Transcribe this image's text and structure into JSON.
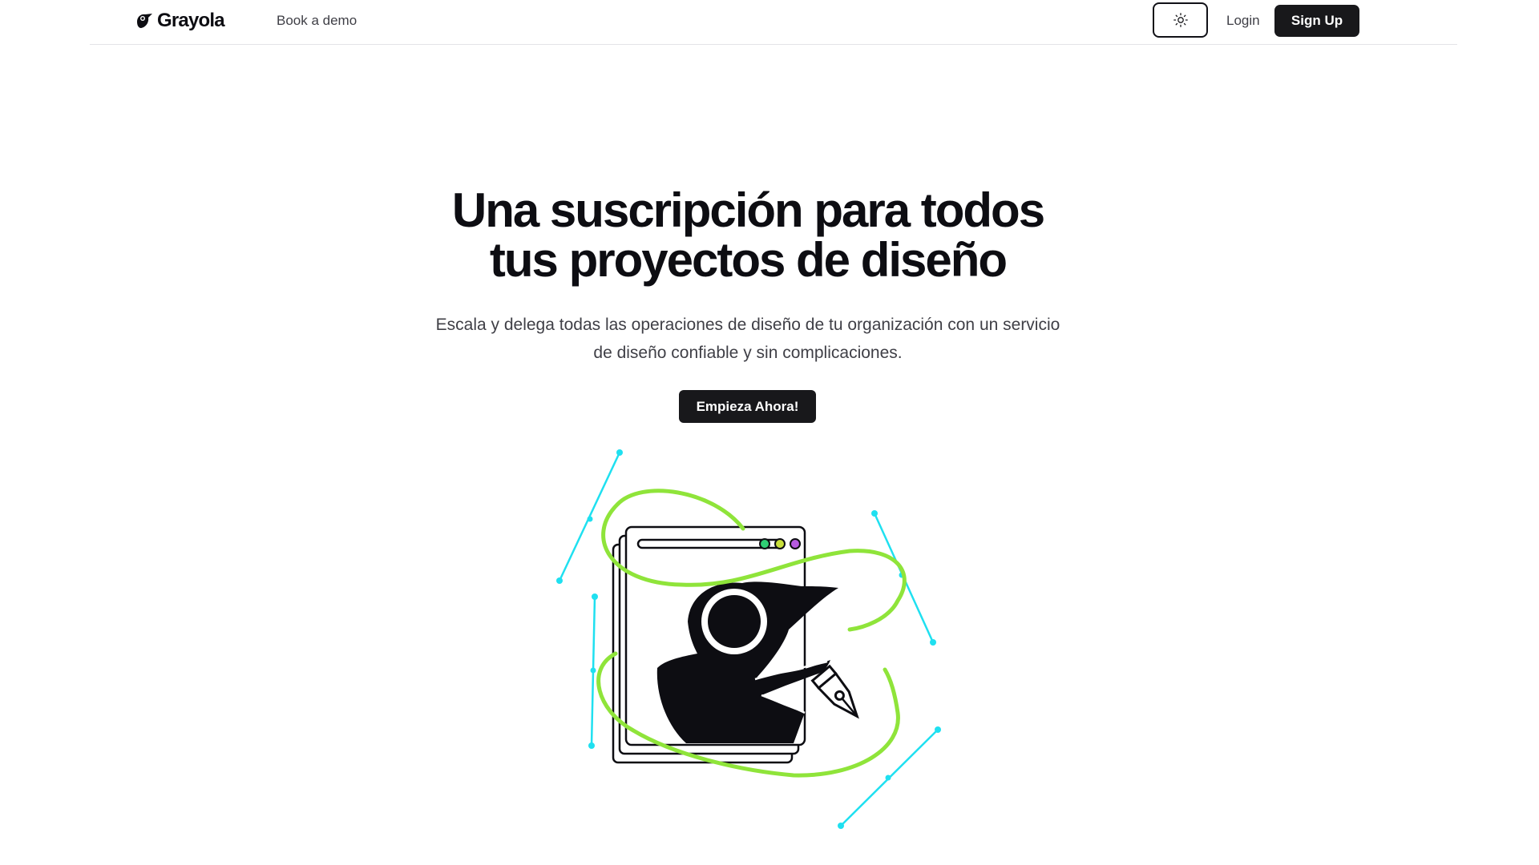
{
  "header": {
    "brand": "Grayola",
    "nav": {
      "book_demo": "Book a demo"
    },
    "theme_toggle_icon": "sun-icon",
    "login": "Login",
    "signup": "Sign Up"
  },
  "hero": {
    "title_lines": [
      "Una suscripción para todos",
      "tus proyectos de diseño"
    ],
    "subtitle_lines": [
      "Escala y delega todas las operaciones de diseño de tu organización con un servicio",
      "de diseño confiable y sin complicaciones."
    ],
    "cta": "Empieza Ahora!"
  },
  "illustration": {
    "icon": "bird-designer-illustration",
    "colors": {
      "lime": "#8fe43a",
      "cyan": "#1fe0f0",
      "ink": "#0d0d12",
      "dot_green": "#2fcf75",
      "dot_yellow": "#c9e03a",
      "dot_purple": "#b65ae0"
    }
  },
  "colors": {
    "primary_button": "#18181b",
    "text": "#0d0d12",
    "muted_text": "#3f3f46",
    "divider": "#e4e4e7"
  }
}
